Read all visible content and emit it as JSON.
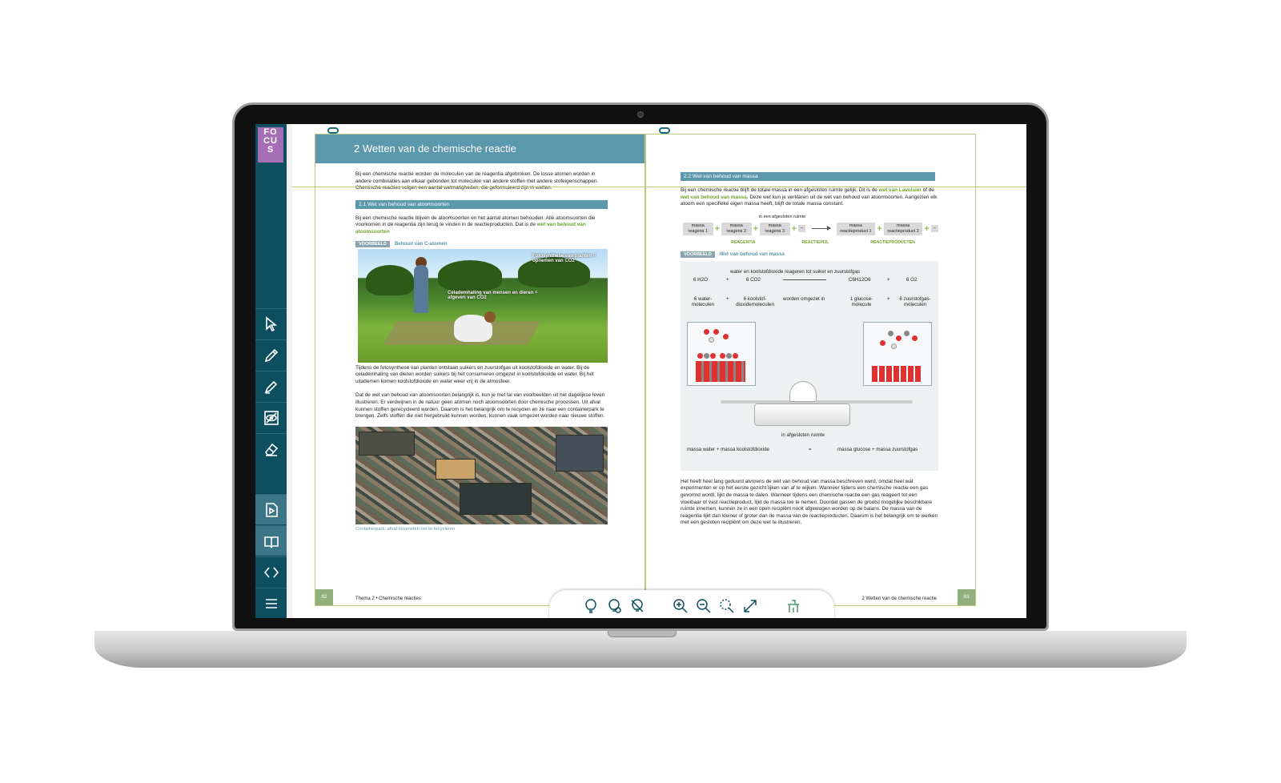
{
  "sidebar": {
    "logo": "FO CU S",
    "tools": [
      "pointer-icon",
      "pencil-icon",
      "marker-icon",
      "hide-icon",
      "eraser-icon",
      "video-icon",
      "book-icon",
      "code-icon",
      "menu-icon"
    ]
  },
  "left_page": {
    "chapter_title": "2  Wetten van de chemische reactie",
    "intro": "Bij een chemische reactie worden de moleculen van de reagentia afgebroken. De losse atomen worden in andere combinaties aan elkaar gebonden tot moleculen van andere stoffen met andere stofeigenschappen. Chemische reacties volgen een aantal wetmatigheden, die geformuleerd zijn in wetten.",
    "section_title": "2.1   Wet van behoud van atoomsoorten",
    "section_text": "Bij een chemische reactie blijven de atoomsoorten en het aantal atomen behouden. Alle atoomsoorten die voorkomen in de reagentia zijn terug te vinden in de reactieproducten. Dat is de",
    "section_link": "wet van behoud van atoomsoorten",
    "example_badge": "VOORBEELD",
    "example_title": "Behoud van C-atomen",
    "photo_label_1": "Fotosynthese van planten = opnemen van CO2",
    "photo_label_2": "Celademhaling van mensen en dieren = afgeven van CO2",
    "photo_caption": "Tijdens de fotosynthese van planten ontstaan suikers en zuurstofgas uit koolstofdioxide en water. Bij de celademhaling van dieren worden suikers bij het consumeren omgezet in koolstofdioxide en water. Bij het uitademen komen koolstofdioxide en water weer vrij in de atmosfeer.",
    "body_text": "Dat de wet van behoud van atoomsoorten belangrijk is, kun je met tal van voorbeelden uit het dagelijkse leven illustreren. Er verdwijnen in de natuur geen atomen noch atoomsoorten door chemische processen. Uit afval kunnen stoffen gerecycleerd worden. Daarom is het belangrijk om te recyclen en ze naar een containerpark te brengen. Zelfs stoffen die niet hergebruikt kunnen worden, kunnen vaak omgezet worden naar nieuwe stoffen.",
    "scrap_caption": "Containerpark: afval inzamelen om te recycleren",
    "page_number": "82",
    "footer": "Thema 2 • Chemische reacties"
  },
  "right_page": {
    "section_title": "2.2   Wet van behoud van massa",
    "section_text_1": "Bij een chemische reactie blijft de totale massa in een afgesloten ruimte gelijk. Dit is de",
    "link_1": "wet van Lavoisier",
    "section_text_2": "of de",
    "link_2": "wet van behoud van massa",
    "section_text_3": ". Deze wet kun je verklaren uit de wet van behoud van atoomsoorten. Aangezien elk atoom een specifieke eigen massa heeft, blijft de totale massa constant.",
    "closed_space": "in een afgesloten ruimte",
    "reagents": [
      "massa reagens 1",
      "massa reagens 2",
      "massa reagens 3"
    ],
    "products": [
      "massa reactieproduct 1",
      "massa reactieproduct 2"
    ],
    "label_reagents": "REAGENTIA",
    "label_arrow": "REACTIEPIJL",
    "label_products": "REACTIEPRODUCTEN",
    "example_badge": "VOORBEELD",
    "example_title": "Wet van behoud van massa",
    "example_heading": "water en koolstofdioxide reageren tot suiker en zuurstofgas",
    "eq_terms": [
      "6 H2O",
      "+",
      "6 CO2",
      "C6H12O6",
      "+",
      "6 O2"
    ],
    "eq_words": [
      "6 water-moleculen",
      "+",
      "6 koolstof-dioxidemoleculen",
      "worden omgezet in",
      "1 glucose-molecule",
      "+",
      "6 zuurstofgas-moleculen"
    ],
    "balance_caption": "in afgesloten ruimte",
    "mass_left": "massa water + massa koolstofdioxide",
    "mass_eq": "=",
    "mass_right": "massa glucose + massa zuurstofgas",
    "body_text": "Het heeft heel lang geduurd alvorens de wet van behoud van massa beschreven werd, omdat heel wat experimenten er op het eerste gezicht lijken van af te wijken. Wanneer tijdens een chemische reactie een gas gevormd wordt, lijkt de massa te dalen. Wanneer tijdens een chemische reactie een gas reageert tot een vloeibaar of vast reactieproduct, lijkt de massa toe te nemen. Doordat gassen de grootst mogelijke beschikbare ruimte innemen, kunnen ze in een open recipiënt nooit afgewogen worden op de balans. De massa van de reagentia lijkt dan kleiner of groter dan de massa van de reactieproducten. Daarom is het belangrijk om te werken met een gesloten recipiënt om deze wet te illustreren.",
    "page_number": "83",
    "footer": "2  Wetten van de chemische reactie"
  },
  "bottom_toolbar": [
    "lightbulb-icon",
    "lightbulb-show-icon",
    "lightbulb-hide-icon",
    "zoom-in-icon",
    "zoom-out-icon",
    "zoom-fit-icon",
    "fullscreen-icon",
    "page-view-icon"
  ]
}
